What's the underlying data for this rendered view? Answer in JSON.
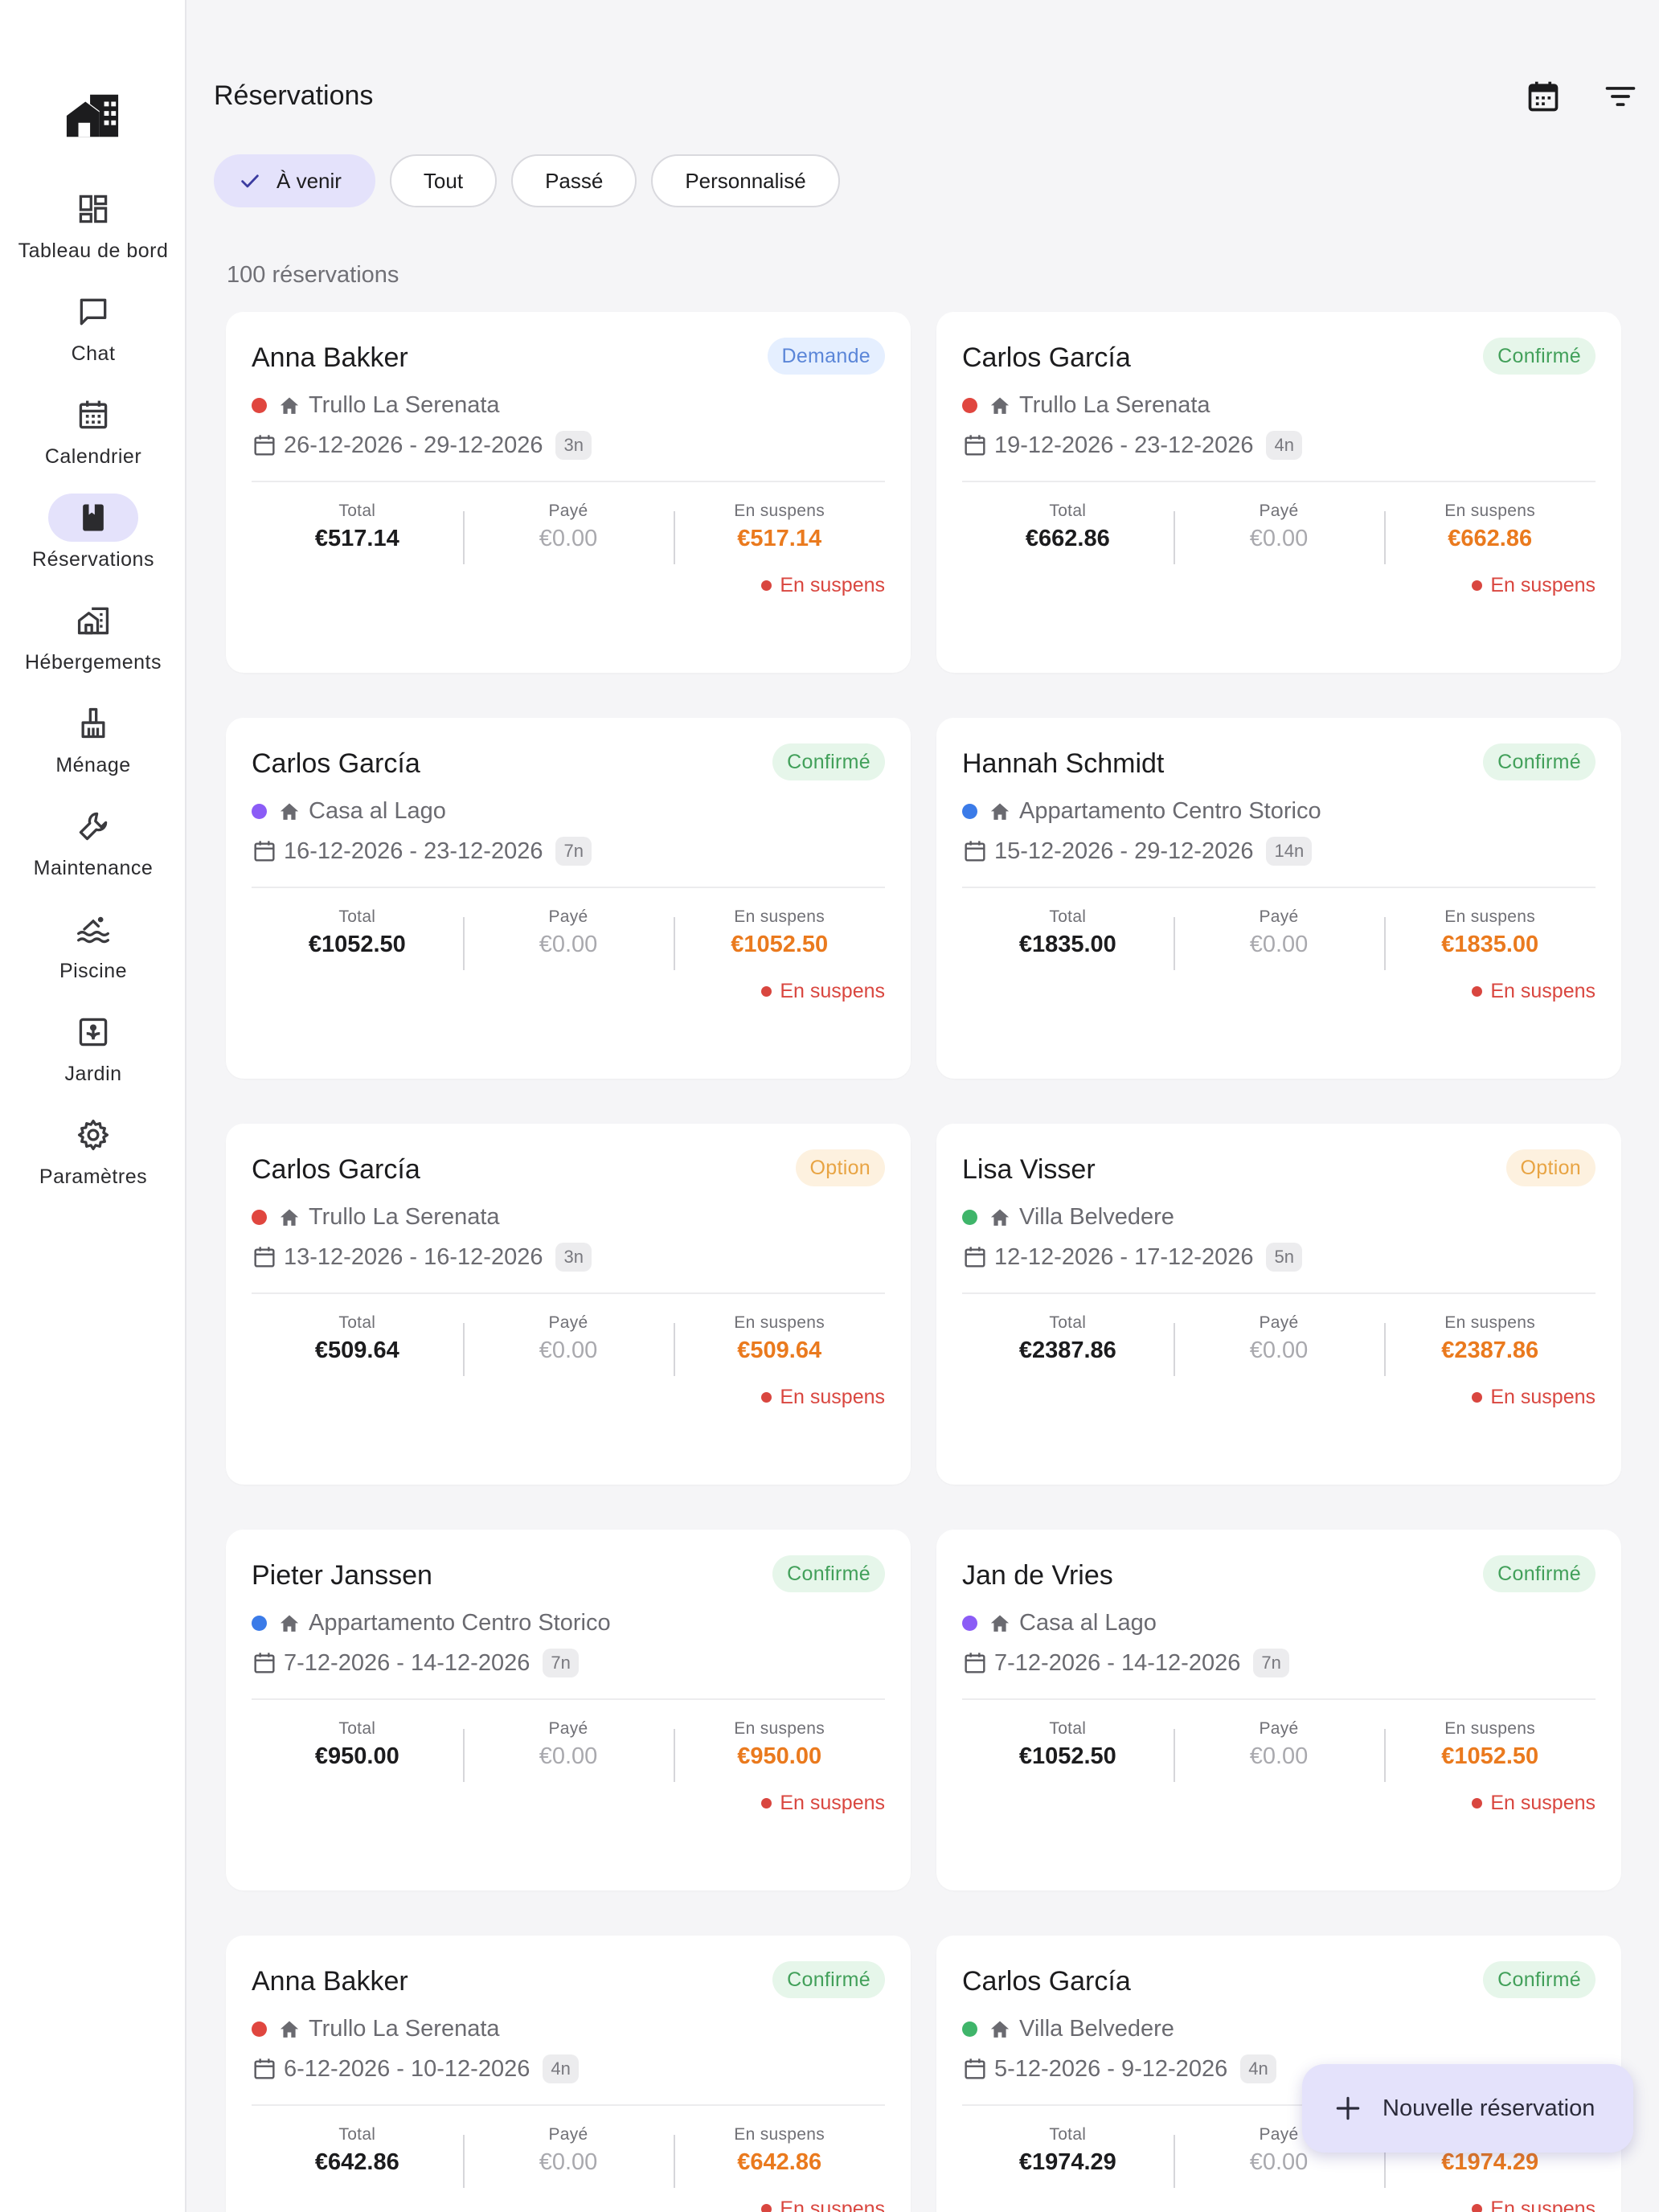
{
  "sidebar": {
    "items": [
      {
        "label": "Tableau de bord",
        "icon": "dashboard-icon",
        "active": false
      },
      {
        "label": "Chat",
        "icon": "chat-icon",
        "active": false
      },
      {
        "label": "Calendrier",
        "icon": "calendar-icon",
        "active": false
      },
      {
        "label": "Réservations",
        "icon": "book-icon",
        "active": true
      },
      {
        "label": "Hébergements",
        "icon": "buildings-icon",
        "active": false
      },
      {
        "label": "Ménage",
        "icon": "broom-icon",
        "active": false
      },
      {
        "label": "Maintenance",
        "icon": "wrench-icon",
        "active": false
      },
      {
        "label": "Piscine",
        "icon": "pool-icon",
        "active": false
      },
      {
        "label": "Jardin",
        "icon": "garden-icon",
        "active": false
      },
      {
        "label": "Paramètres",
        "icon": "gear-icon",
        "active": false
      }
    ]
  },
  "header": {
    "title": "Réservations"
  },
  "filters": [
    {
      "label": "À venir",
      "selected": true
    },
    {
      "label": "Tout",
      "selected": false
    },
    {
      "label": "Passé",
      "selected": false
    },
    {
      "label": "Personnalisé",
      "selected": false
    }
  ],
  "count_label": "100 réservations",
  "labels": {
    "total": "Total",
    "paid": "Payé",
    "pending": "En suspens"
  },
  "colors": {
    "accent": "#e4e2fb",
    "pending_amount": "#ea7a1e",
    "pending_status": "#d9463f"
  },
  "reservations": [
    {
      "guest": "Anna Bakker",
      "status": "Demande",
      "status_type": "demande",
      "property": "Trullo La Serenata",
      "dot": "#e0463f",
      "dates": "26-12-2026 - 29-12-2026",
      "nights": "3n",
      "total": "€517.14",
      "paid": "€0.00",
      "pending": "€517.14",
      "payment_status": "En suspens"
    },
    {
      "guest": "Carlos García",
      "status": "Confirmé",
      "status_type": "confirme",
      "property": "Trullo La Serenata",
      "dot": "#e0463f",
      "dates": "19-12-2026 - 23-12-2026",
      "nights": "4n",
      "total": "€662.86",
      "paid": "€0.00",
      "pending": "€662.86",
      "payment_status": "En suspens"
    },
    {
      "guest": "Carlos García",
      "status": "Confirmé",
      "status_type": "confirme",
      "property": "Casa al Lago",
      "dot": "#8b5cf6",
      "dates": "16-12-2026 - 23-12-2026",
      "nights": "7n",
      "total": "€1052.50",
      "paid": "€0.00",
      "pending": "€1052.50",
      "payment_status": "En suspens"
    },
    {
      "guest": "Hannah Schmidt",
      "status": "Confirmé",
      "status_type": "confirme",
      "property": "Appartamento Centro Storico",
      "dot": "#3b7be8",
      "dates": "15-12-2026 - 29-12-2026",
      "nights": "14n",
      "total": "€1835.00",
      "paid": "€0.00",
      "pending": "€1835.00",
      "payment_status": "En suspens"
    },
    {
      "guest": "Carlos García",
      "status": "Option",
      "status_type": "option",
      "property": "Trullo La Serenata",
      "dot": "#e0463f",
      "dates": "13-12-2026 - 16-12-2026",
      "nights": "3n",
      "total": "€509.64",
      "paid": "€0.00",
      "pending": "€509.64",
      "payment_status": "En suspens"
    },
    {
      "guest": "Lisa Visser",
      "status": "Option",
      "status_type": "option",
      "property": "Villa Belvedere",
      "dot": "#3fb56a",
      "dates": "12-12-2026 - 17-12-2026",
      "nights": "5n",
      "total": "€2387.86",
      "paid": "€0.00",
      "pending": "€2387.86",
      "payment_status": "En suspens"
    },
    {
      "guest": "Pieter Janssen",
      "status": "Confirmé",
      "status_type": "confirme",
      "property": "Appartamento Centro Storico",
      "dot": "#3b7be8",
      "dates": "7-12-2026 - 14-12-2026",
      "nights": "7n",
      "total": "€950.00",
      "paid": "€0.00",
      "pending": "€950.00",
      "payment_status": "En suspens"
    },
    {
      "guest": "Jan de Vries",
      "status": "Confirmé",
      "status_type": "confirme",
      "property": "Casa al Lago",
      "dot": "#8b5cf6",
      "dates": "7-12-2026 - 14-12-2026",
      "nights": "7n",
      "total": "€1052.50",
      "paid": "€0.00",
      "pending": "€1052.50",
      "payment_status": "En suspens"
    },
    {
      "guest": "Anna Bakker",
      "status": "Confirmé",
      "status_type": "confirme",
      "property": "Trullo La Serenata",
      "dot": "#e0463f",
      "dates": "6-12-2026 - 10-12-2026",
      "nights": "4n",
      "total": "€642.86",
      "paid": "€0.00",
      "pending": "€642.86",
      "payment_status": "En suspens"
    },
    {
      "guest": "Carlos García",
      "status": "Confirmé",
      "status_type": "confirme",
      "property": "Villa Belvedere",
      "dot": "#3fb56a",
      "dates": "5-12-2026 - 9-12-2026",
      "nights": "4n",
      "total": "€1974.29",
      "paid": "€0.00",
      "pending": "€1974.29",
      "payment_status": "En suspens"
    }
  ],
  "fab": {
    "label": "Nouvelle réservation",
    "icon": "plus-icon"
  }
}
